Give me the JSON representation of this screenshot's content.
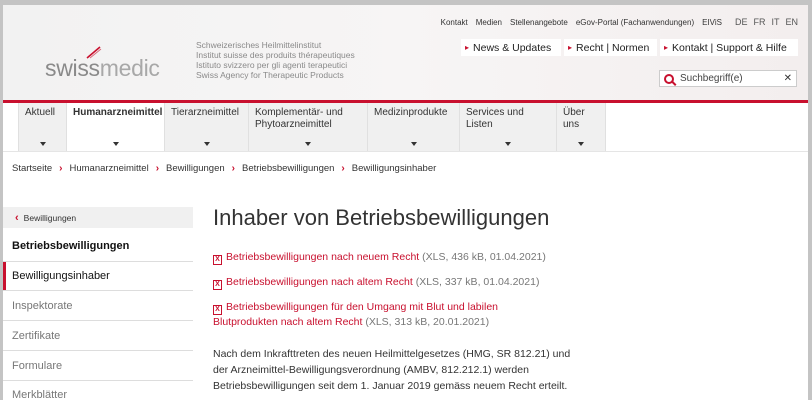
{
  "header": {
    "logo_left": "swiss",
    "logo_right": "medic",
    "institute_lines": [
      "Schweizerisches Heilmittelinstitut",
      "Institut suisse des produits thérapeutiques",
      "Istituto svizzero per gli agenti terapeutici",
      "Swiss Agency for Therapeutic Products"
    ],
    "top_links": [
      "Kontakt",
      "Medien",
      "Stellenangebote",
      "eGov-Portal (Fachanwendungen)",
      "EIViS"
    ],
    "languages": [
      "DE",
      "FR",
      "IT",
      "EN"
    ],
    "service_links": [
      "News & Updates",
      "Recht | Normen",
      "Kontakt | Support & Hilfe"
    ],
    "search": {
      "placeholder": "Suchbegriff(e)",
      "clear": "✕"
    }
  },
  "nav": {
    "items": [
      {
        "label": "Aktuell",
        "label2": ""
      },
      {
        "label": "Humanarzneimittel",
        "label2": ""
      },
      {
        "label": "Tierarzneimittel",
        "label2": ""
      },
      {
        "label": "Komplementär- und",
        "label2": "Phytoarzneimittel"
      },
      {
        "label": "Medizinprodukte",
        "label2": ""
      },
      {
        "label": "Services und Listen",
        "label2": ""
      },
      {
        "label": "Über uns",
        "label2": ""
      }
    ],
    "active_index": 1
  },
  "breadcrumb": [
    "Startseite",
    "Humanarzneimittel",
    "Bewilligungen",
    "Betriebsbewilligungen",
    "Bewilligungsinhaber"
  ],
  "sidebar": {
    "back_label": "Bewilligungen",
    "heading": "Betriebsbewilligungen",
    "items": [
      "Bewilligungsinhaber",
      "Inspektorate",
      "Zertifikate",
      "Formulare",
      "Merkblätter"
    ],
    "active_index": 0
  },
  "main": {
    "title": "Inhaber von Betriebsbewilligungen",
    "file_icon_text": "X",
    "documents": [
      {
        "link": "Betriebsbewilligungen nach neuem Recht",
        "link2": "",
        "meta": " (XLS, 436 kB, 01.04.2021)"
      },
      {
        "link": "Betriebsbewilligungen nach altem Recht",
        "link2": "",
        "meta": " (XLS, 337 kB, 01.04.2021)"
      },
      {
        "link": "Betriebsbewilligungen für den Umgang mit Blut und labilen",
        "link2": "Blutprodukten nach altem Recht",
        "meta": " (XLS, 313 kB, 20.01.2021)"
      }
    ],
    "paragraph_lines": [
      "Nach dem Inkrafttreten des neuen Heilmittelgesetzes (HMG, SR 812.21) und",
      "der Arzneimittel-Bewilligungsverordnung (AMBV, 812.212.1) werden",
      "Betriebsbewilligungen seit dem 1. Januar 2019 gemäss neuem Recht erteilt."
    ]
  },
  "colors": {
    "brand_red": "#c8102e",
    "nav_bg": "#f0f0f0",
    "text": "#333333"
  },
  "icons": {
    "service_arrow": "▸",
    "crumb_sep": "›",
    "back_arrow": "‹",
    "file": "xls-file-icon",
    "search": "search-icon"
  }
}
